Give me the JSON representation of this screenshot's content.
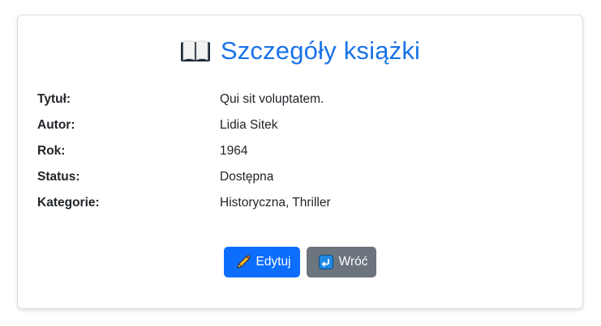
{
  "header": {
    "icon": "open-book-icon",
    "title": "Szczegóły książki",
    "title_color": "#1a73e8"
  },
  "details": [
    {
      "label": "Tytuł:",
      "value": "Qui sit voluptatem."
    },
    {
      "label": "Autor:",
      "value": "Lidia Sitek"
    },
    {
      "label": "Rok:",
      "value": "1964"
    },
    {
      "label": "Status:",
      "value": "Dostępna"
    },
    {
      "label": "Kategorie:",
      "value": "Historyczna, Thriller"
    }
  ],
  "actions": {
    "edit": {
      "label": "Edytuj",
      "icon": "pencil-icon",
      "color": "#0d6efd"
    },
    "back": {
      "label": "Wróć",
      "icon": "return-arrow-icon",
      "color": "#6c757d"
    }
  }
}
